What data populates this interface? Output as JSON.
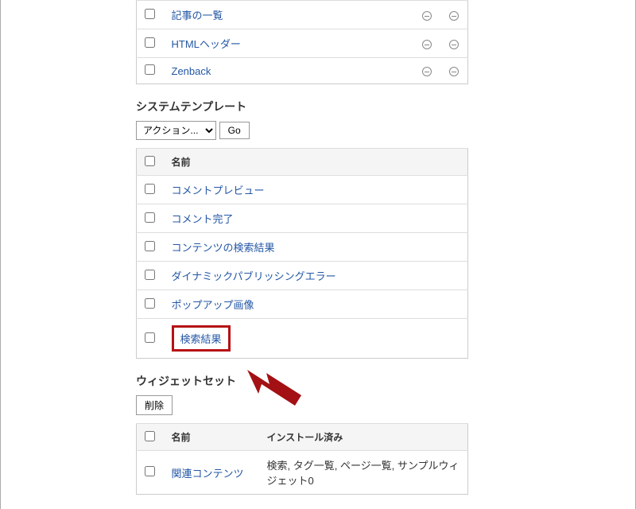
{
  "top_table": {
    "rows": [
      {
        "label": "記事の一覧",
        "hasStatusIcons": true
      },
      {
        "label": "HTMLヘッダー",
        "hasStatusIcons": true
      },
      {
        "label": "Zenback",
        "hasStatusIcons": true
      }
    ]
  },
  "system_templates": {
    "heading": "システムテンプレート",
    "action_placeholder": "アクション...",
    "go_label": "Go",
    "header_name": "名前",
    "rows": [
      {
        "label": "コメントプレビュー",
        "highlighted": false
      },
      {
        "label": "コメント完了",
        "highlighted": false
      },
      {
        "label": "コンテンツの検索結果",
        "highlighted": false
      },
      {
        "label": "ダイナミックパブリッシングエラー",
        "highlighted": false
      },
      {
        "label": "ポップアップ画像",
        "highlighted": false
      },
      {
        "label": "検索結果",
        "highlighted": true
      }
    ]
  },
  "widget_set": {
    "heading": "ウィジェットセット",
    "delete_label": "削除",
    "header_name": "名前",
    "header_installed": "インストール済み",
    "rows": [
      {
        "name": "関連コンテンツ",
        "installed": "検索, タグ一覧, ページ一覧, サンプルウィジェット0"
      }
    ]
  },
  "colors": {
    "link": "#2457a5",
    "highlight_border": "#b51215",
    "arrow": "#a31114"
  }
}
